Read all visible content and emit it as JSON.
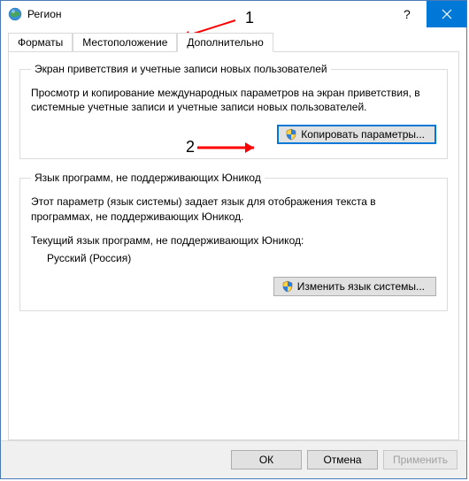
{
  "window": {
    "title": "Регион"
  },
  "tabs": {
    "formats": "Форматы",
    "location": "Местоположение",
    "advanced": "Дополнительно"
  },
  "group1": {
    "legend": "Экран приветствия и учетные записи новых пользователей",
    "desc": "Просмотр и копирование международных параметров на экран приветствия, в системные учетные записи и учетные записи новых пользователей.",
    "button": "Копировать параметры..."
  },
  "group2": {
    "legend": "Язык программ, не поддерживающих Юникод",
    "desc": "Этот параметр (язык системы) задает язык для отображения текста в программах, не поддерживающих Юникод.",
    "current_label": "Текущий язык программ, не поддерживающих Юникод:",
    "current_value": "Русский (Россия)",
    "button": "Изменить язык системы..."
  },
  "footer": {
    "ok": "ОК",
    "cancel": "Отмена",
    "apply": "Применить"
  },
  "annotations": {
    "n1": "1",
    "n2": "2"
  }
}
